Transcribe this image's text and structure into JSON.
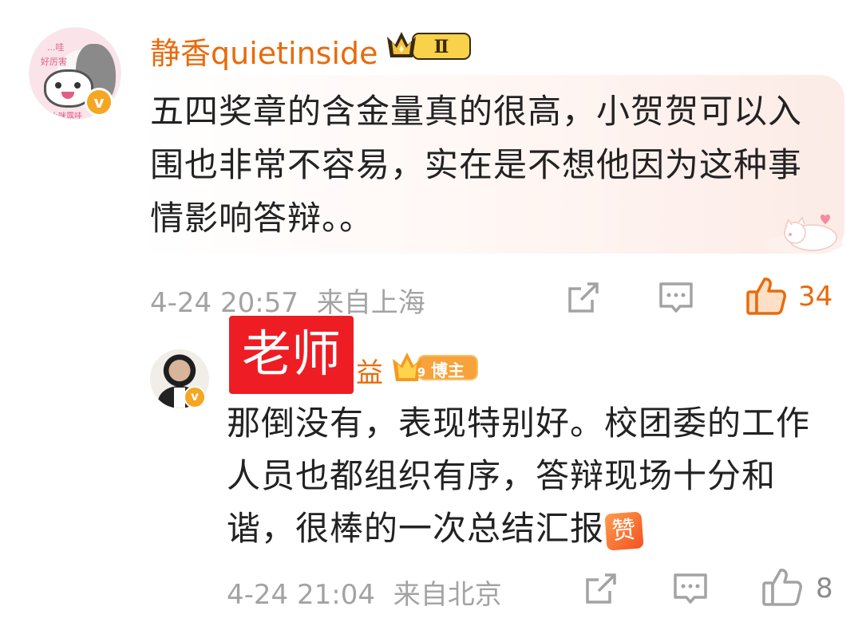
{
  "main_comment": {
    "username": "静香quietinside",
    "avatar_text_line1": "...哇",
    "avatar_text_line2": "好厉害",
    "avatar_signature": "小咪露哇",
    "verified_mark": "v",
    "level_badge": "Ⅱ",
    "text": "五四奖章的含金量真的很高，小贺贺可以入围也非常不容易，实在是不想他因为这种事情影响答辩。。",
    "timestamp": "4-24 20:57",
    "location": "来自上海",
    "like_count": "34",
    "icons": {
      "share": "share-icon",
      "reply": "comment-icon",
      "like": "thumbs-up-icon"
    }
  },
  "reply_comment": {
    "overlay_label": "老师",
    "username_visible_tail": "益",
    "verified_mark": "v",
    "role_badge_number": "9",
    "role_badge": "博主",
    "text": "那倒没有，表现特别好。校团委的工作人员也都组织有序，答辩现场十分和谐，很棒的一次总结汇报",
    "emoji": "赞",
    "timestamp": "4-24 21:04",
    "location": "来自北京",
    "like_count": "8"
  },
  "colors": {
    "username": "#e86b0c",
    "meta_gray": "#a3a3a3",
    "liked": "#e86b0c",
    "overlay_red": "#ee1d23",
    "verified": "#f5a623"
  }
}
